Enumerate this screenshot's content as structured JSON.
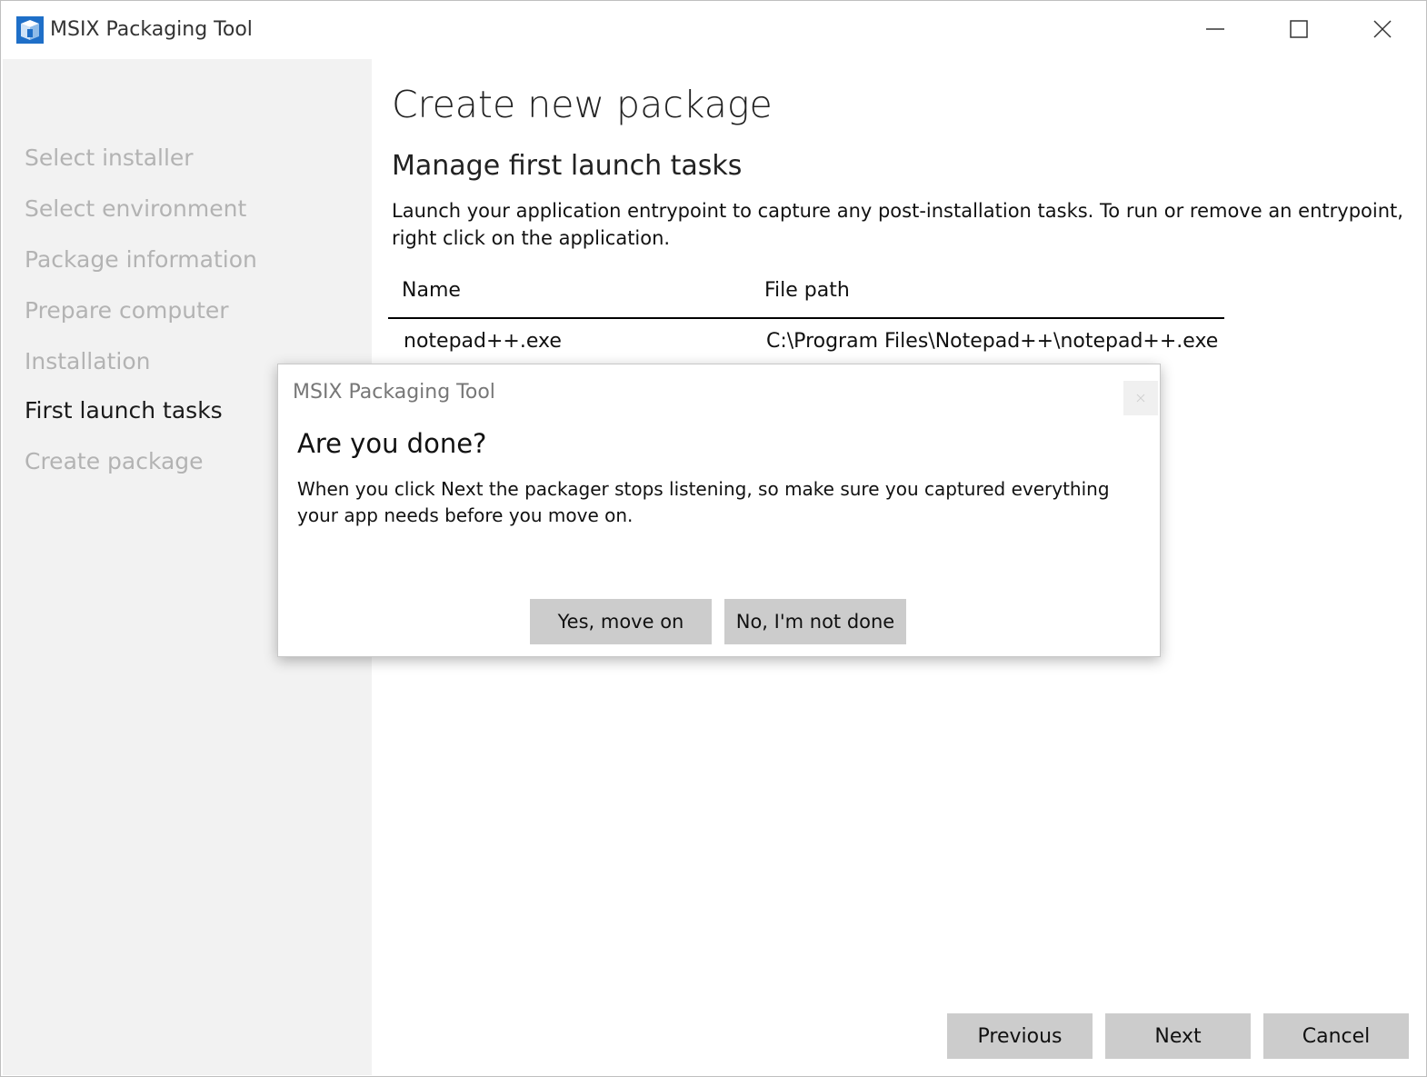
{
  "window": {
    "title": "MSIX Packaging Tool"
  },
  "sidebar": {
    "steps": [
      {
        "label": "Select installer",
        "state": "inactive"
      },
      {
        "label": "Select environment",
        "state": "inactive"
      },
      {
        "label": "Package information",
        "state": "inactive"
      },
      {
        "label": "Prepare computer",
        "state": "inactive"
      },
      {
        "label": "Installation",
        "state": "inactive"
      },
      {
        "label": "First launch tasks",
        "state": "active"
      },
      {
        "label": "Create package",
        "state": "inactive"
      }
    ]
  },
  "main": {
    "title": "Create new package",
    "section_title": "Manage first launch tasks",
    "description": "Launch your application entrypoint to capture any post-installation tasks. To run or remove an entrypoint, right click on the application.",
    "table": {
      "columns": [
        "Name",
        "File path"
      ],
      "rows": [
        {
          "name": "notepad++.exe",
          "path": "C:\\Program Files\\Notepad++\\notepad++.exe"
        }
      ]
    }
  },
  "footer": {
    "previous_label": "Previous",
    "next_label": "Next",
    "cancel_label": "Cancel"
  },
  "dialog": {
    "title": "MSIX Packaging Tool",
    "heading": "Are you done?",
    "message": "When you click Next the packager stops listening, so make sure you captured everything your app needs before you move on.",
    "yes_label": "Yes, move on",
    "no_label": "No, I'm not done"
  },
  "colors": {
    "sidebar_bg": "#f2f2f2",
    "inactive_step": "#b3b3b3",
    "button_bg": "#cccccc",
    "icon_blue": "#1e6fc8"
  }
}
